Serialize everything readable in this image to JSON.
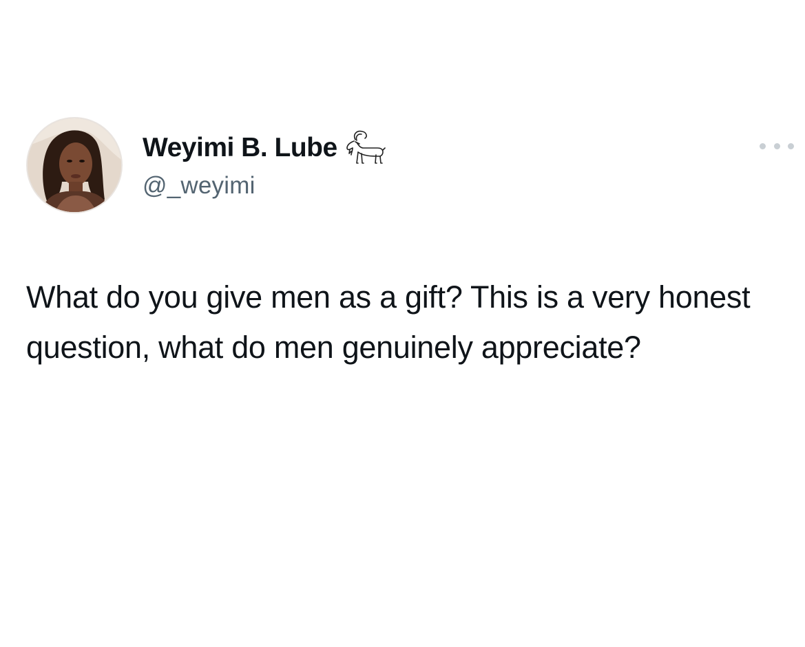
{
  "tweet": {
    "author": {
      "display_name": "Weyimi B. Lube",
      "handle": "@_weyimi",
      "name_emoji": "goat-icon"
    },
    "text": "What do you give men as a gift? This is a very honest question, what do men genuinely appreciate?",
    "more_menu": "more-options-icon"
  },
  "colors": {
    "background": "#ffffff",
    "text_primary": "#0f1419",
    "text_secondary": "#536471",
    "more_dots": "#c9cfd4"
  }
}
